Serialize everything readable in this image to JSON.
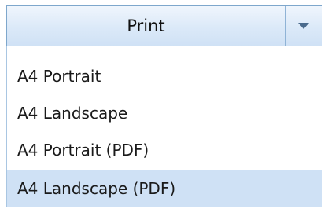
{
  "print_control": {
    "button_label": "Print",
    "dropdown_icon": "chevron-down-icon",
    "accent_color": "#cfe1f5",
    "border_color": "#7ea7cc",
    "menu_items": [
      {
        "label": "A4 Portrait",
        "selected": false
      },
      {
        "label": "A4 Landscape",
        "selected": false
      },
      {
        "label": "A4 Portrait (PDF)",
        "selected": false
      },
      {
        "label": "A4 Landscape (PDF)",
        "selected": true
      }
    ]
  }
}
